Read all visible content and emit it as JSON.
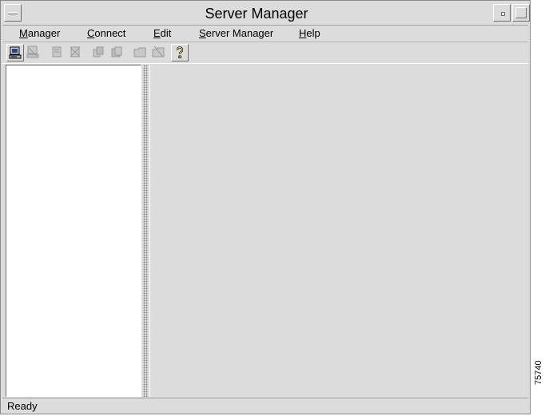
{
  "window": {
    "title": "Server Manager"
  },
  "menubar": {
    "items": [
      {
        "label": "Manager",
        "mnemonic": "M",
        "rest": "anager"
      },
      {
        "label": "Connect",
        "mnemonic": "C",
        "rest": "onnect"
      },
      {
        "label": "Edit",
        "mnemonic": "E",
        "rest": "dit"
      },
      {
        "label": "Server Manager",
        "mnemonic": "S",
        "rest": "erver Manager"
      },
      {
        "label": "Help",
        "mnemonic": "H",
        "rest": "elp"
      }
    ]
  },
  "toolbar": {
    "buttons": [
      {
        "icon": "computer-icon",
        "enabled": true
      },
      {
        "icon": "computer-disconnect-icon",
        "enabled": false
      },
      {
        "icon": "server-add-icon",
        "enabled": false
      },
      {
        "icon": "server-remove-icon",
        "enabled": false
      },
      {
        "icon": "copy-icon",
        "enabled": false
      },
      {
        "icon": "paste-icon",
        "enabled": false
      },
      {
        "icon": "folder-add-icon",
        "enabled": false
      },
      {
        "icon": "folder-delete-icon",
        "enabled": false
      },
      {
        "icon": "help-icon",
        "enabled": true
      }
    ]
  },
  "statusbar": {
    "text": "Ready"
  },
  "figure_number": "75740",
  "colors": {
    "window_bg": "#dcdcdc",
    "pane_bg": "#ffffff",
    "help_yellow": "#f0e060"
  }
}
